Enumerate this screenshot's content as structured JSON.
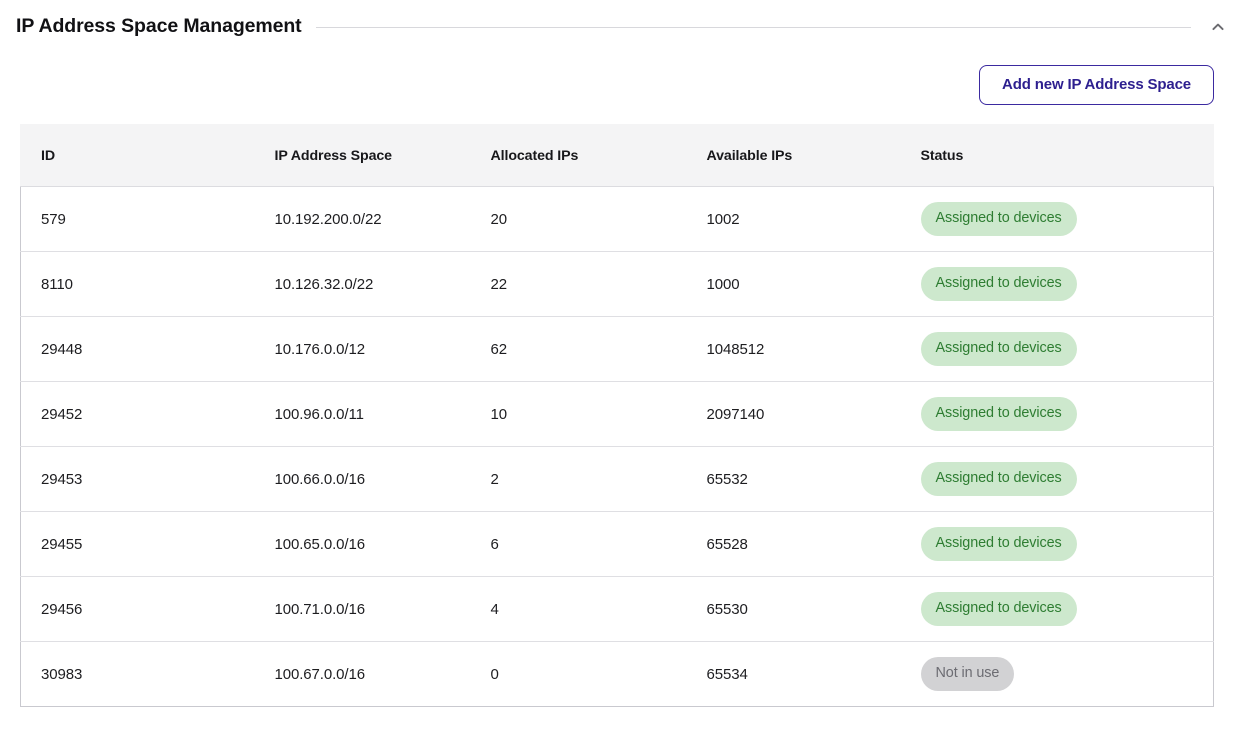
{
  "section": {
    "title": "IP Address Space Management",
    "collapse_icon": "chevron-up-icon"
  },
  "toolbar": {
    "add_label": "Add new IP Address Space",
    "accent_color": "#2d1f8f"
  },
  "table": {
    "columns": [
      "ID",
      "IP Address Space",
      "Allocated IPs",
      "Available IPs",
      "Status"
    ],
    "status_colors": {
      "assigned_bg": "#cde8cd",
      "assigned_fg": "#2e7d32",
      "unused_bg": "#d2d2d4",
      "unused_fg": "#6c6c72"
    },
    "rows": [
      {
        "id": "579",
        "space": "10.192.200.0/22",
        "allocated": "20",
        "available": "1002",
        "status": "Assigned to devices"
      },
      {
        "id": "8110",
        "space": "10.126.32.0/22",
        "allocated": "22",
        "available": "1000",
        "status": "Assigned to devices"
      },
      {
        "id": "29448",
        "space": "10.176.0.0/12",
        "allocated": "62",
        "available": "1048512",
        "status": "Assigned to devices"
      },
      {
        "id": "29452",
        "space": "100.96.0.0/11",
        "allocated": "10",
        "available": "2097140",
        "status": "Assigned to devices"
      },
      {
        "id": "29453",
        "space": "100.66.0.0/16",
        "allocated": "2",
        "available": "65532",
        "status": "Assigned to devices"
      },
      {
        "id": "29455",
        "space": "100.65.0.0/16",
        "allocated": "6",
        "available": "65528",
        "status": "Assigned to devices"
      },
      {
        "id": "29456",
        "space": "100.71.0.0/16",
        "allocated": "4",
        "available": "65530",
        "status": "Assigned to devices"
      },
      {
        "id": "30983",
        "space": "100.67.0.0/16",
        "allocated": "0",
        "available": "65534",
        "status": "Not in use"
      }
    ]
  }
}
